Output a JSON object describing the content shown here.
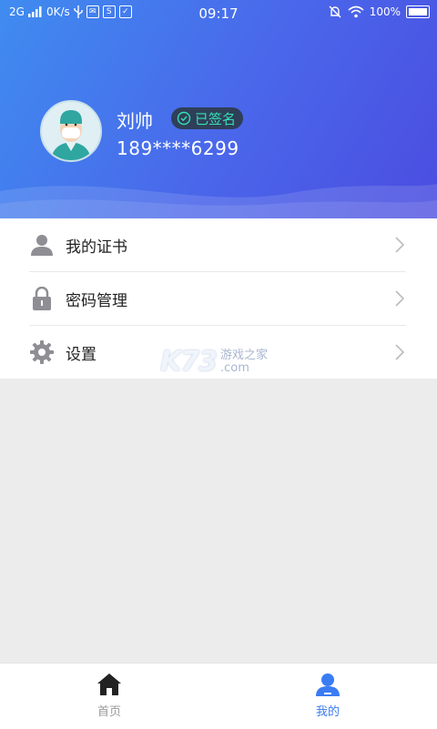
{
  "status_bar": {
    "network": "2G",
    "speed": "0K/s",
    "time": "09:17",
    "battery": "100%"
  },
  "profile": {
    "name": "刘帅",
    "signed_badge": "已签名",
    "phone": "189****6299"
  },
  "menu": {
    "items": [
      {
        "label": "我的证书",
        "icon": "user-icon"
      },
      {
        "label": "密码管理",
        "icon": "lock-icon"
      },
      {
        "label": "设置",
        "icon": "gear-icon"
      }
    ]
  },
  "watermark": {
    "logo": "K73",
    "cn_text": "游戏之家",
    "com_text": ".com"
  },
  "tabbar": {
    "tabs": [
      {
        "label": "首页",
        "icon": "home-icon",
        "active": false
      },
      {
        "label": "我的",
        "icon": "profile-icon",
        "active": true
      }
    ]
  },
  "colors": {
    "header_start": "#3f8cf0",
    "header_end": "#4b4de0",
    "badge_text": "#35e0b5",
    "active_tab": "#3a7cf2",
    "inactive_tab": "#999999"
  }
}
